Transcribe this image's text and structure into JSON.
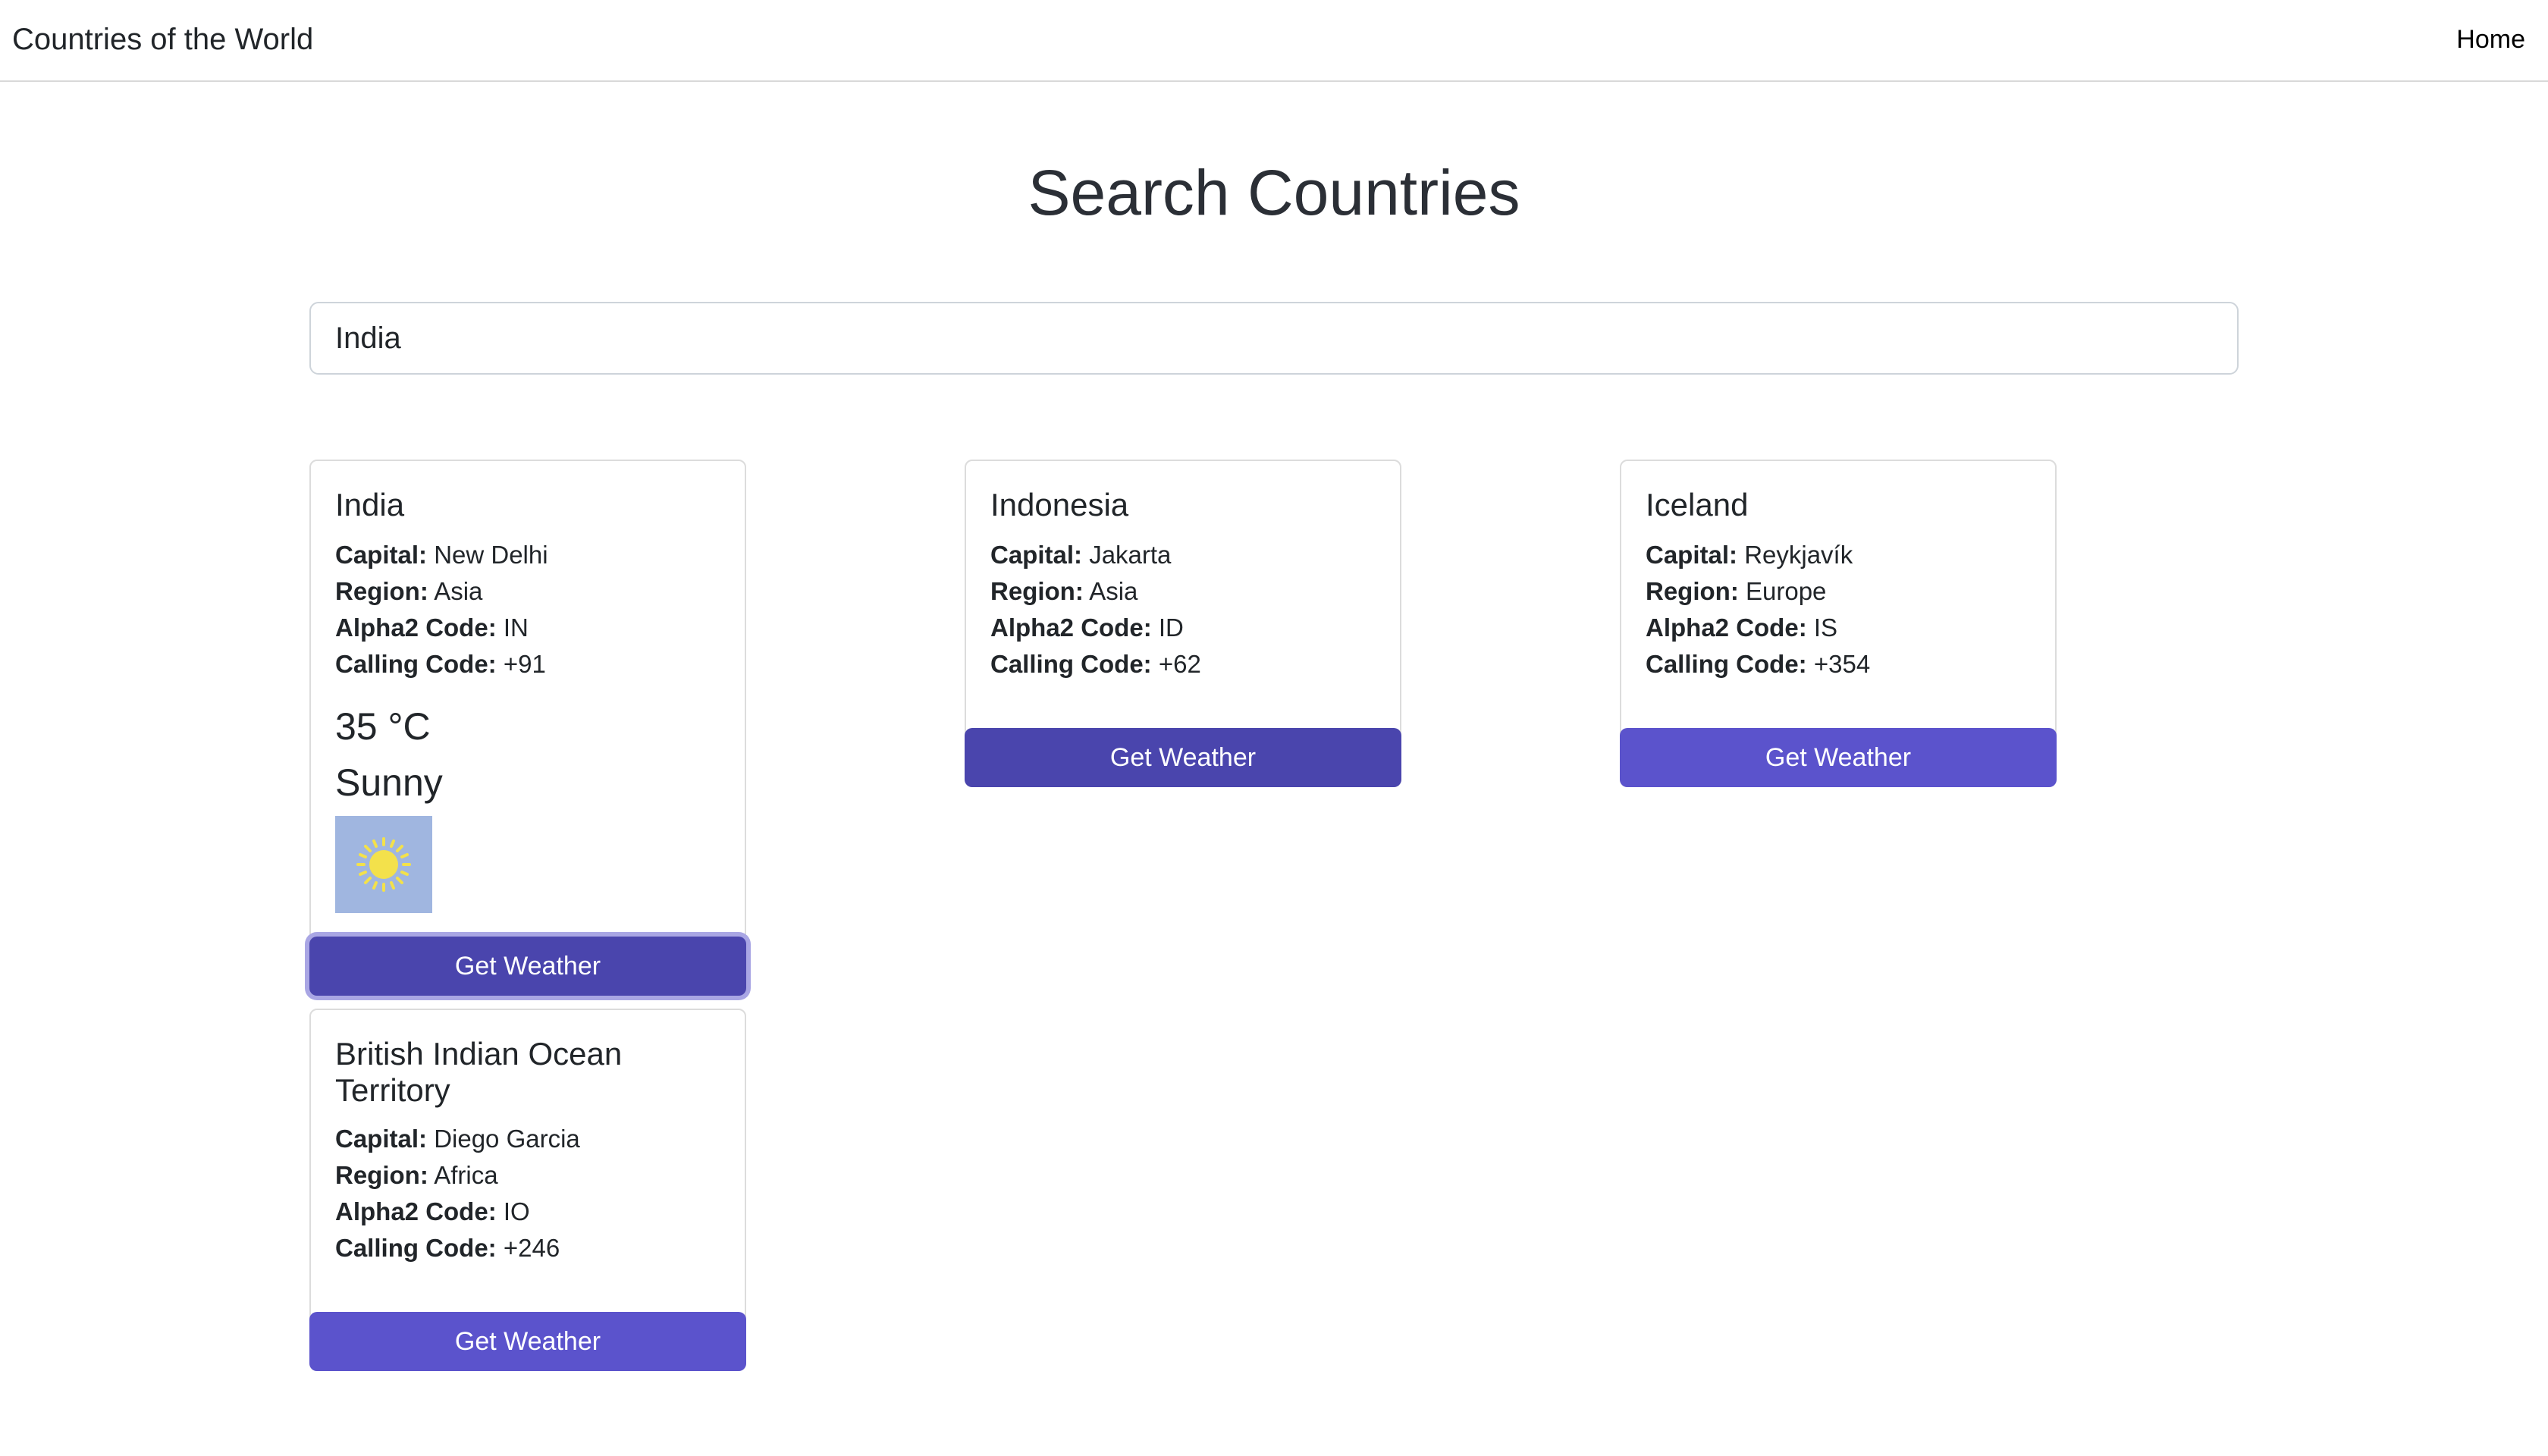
{
  "navbar": {
    "brand": "Countries of the World",
    "home_label": "Home"
  },
  "page": {
    "title": "Search Countries"
  },
  "search": {
    "value": "India",
    "placeholder": ""
  },
  "labels": {
    "capital": "Capital:",
    "region": "Region:",
    "alpha2": "Alpha2 Code:",
    "calling": "Calling Code:"
  },
  "cards": [
    {
      "name": "India",
      "capital": "New Delhi",
      "region": "Asia",
      "alpha2": "IN",
      "calling_code": "+91",
      "weather": {
        "temperature": "35 °C",
        "description": "Sunny",
        "icon": "sun-icon"
      },
      "button_label": "Get Weather"
    },
    {
      "name": "Indonesia",
      "capital": "Jakarta",
      "region": "Asia",
      "alpha2": "ID",
      "calling_code": "+62",
      "button_label": "Get Weather"
    },
    {
      "name": "Iceland",
      "capital": "Reykjavík",
      "region": "Europe",
      "alpha2": "IS",
      "calling_code": "+354",
      "button_label": "Get Weather"
    },
    {
      "name": "British Indian Ocean Territory",
      "capital": "Diego Garcia",
      "region": "Africa",
      "alpha2": "IO",
      "calling_code": "+246",
      "button_label": "Get Weather"
    }
  ],
  "colors": {
    "button": "#5b53cc",
    "button_active": "#4a45ad",
    "weather_icon_bg": "#a0b6e0",
    "sun": "#f3e14b"
  }
}
